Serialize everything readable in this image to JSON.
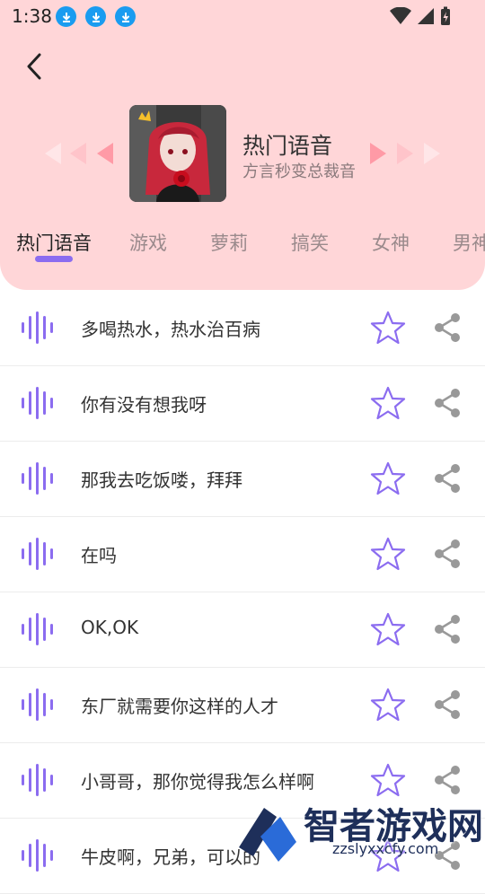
{
  "status_bar": {
    "time": "1:38",
    "notification_icons": [
      "download-icon",
      "download-icon",
      "download-icon"
    ],
    "right_icons": [
      "wifi-icon",
      "signal-icon",
      "battery-charging-icon"
    ]
  },
  "header": {
    "back_icon": "chevron-left-icon",
    "cover_icon": "anime-avatar",
    "title": "热门语音",
    "subtitle": "方言秒变总裁音"
  },
  "tabs": [
    {
      "label": "热门语音",
      "active": true
    },
    {
      "label": "游戏",
      "active": false
    },
    {
      "label": "萝莉",
      "active": false
    },
    {
      "label": "搞笑",
      "active": false
    },
    {
      "label": "女神",
      "active": false
    },
    {
      "label": "男神",
      "active": false
    }
  ],
  "voices": [
    {
      "text": "多喝热水，热水治百病"
    },
    {
      "text": "你有没有想我呀"
    },
    {
      "text": "那我去吃饭喽，拜拜"
    },
    {
      "text": "在吗"
    },
    {
      "text": "OK,OK"
    },
    {
      "text": "东厂就需要你这样的人才"
    },
    {
      "text": "小哥哥，那你觉得我怎么样啊"
    },
    {
      "text": "牛皮啊，兄弟，可以的"
    }
  ],
  "watermark": {
    "name": "智者游戏网",
    "url": "zzslyxxcfy.com"
  },
  "colors": {
    "header_bg": "#ffd6d8",
    "accent_purple": "#8b6cf0",
    "arrow_pink": "#ffa3ad"
  }
}
